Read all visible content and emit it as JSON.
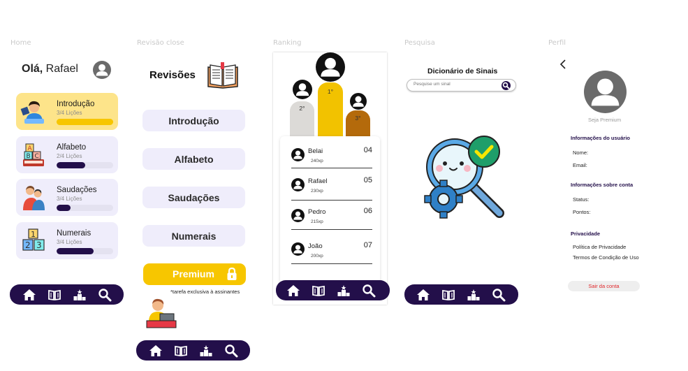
{
  "frames": {
    "home": "Home",
    "revisao": "Revisão close",
    "ranking": "Ranking",
    "pesquisa": "Pesquisa",
    "perfil": "Perfil"
  },
  "home": {
    "greeting_bold": "Olá,",
    "greeting_name": " Rafael",
    "lessons": [
      {
        "title": "Introdução",
        "progress_text": "3/4 Lições",
        "progress": 1.0,
        "icon": "teacher-icon"
      },
      {
        "title": "Alfabeto",
        "progress_text": "2/4 Lições",
        "progress": 0.5,
        "icon": "abc-blocks-book-icon"
      },
      {
        "title": "Saudações",
        "progress_text": "3/4 Lições",
        "progress": 0.25,
        "icon": "hug-people-icon"
      },
      {
        "title": "Numerais",
        "progress_text": "3/4 Lições",
        "progress": 0.65,
        "icon": "number-blocks-icon"
      }
    ]
  },
  "revisao": {
    "title": "Revisões",
    "items": [
      "Introdução",
      "Alfabeto",
      "Saudações",
      "Numerais"
    ],
    "premium_label": "Premium",
    "exclusive_note": "*tarefa exclusiva à assinantes"
  },
  "ranking": {
    "podium": [
      "2°",
      "1°",
      "3°"
    ],
    "rows": [
      {
        "name": "Belai",
        "xp": "240xp",
        "pos": "04"
      },
      {
        "name": "Rafael",
        "xp": "230xp",
        "pos": "05"
      },
      {
        "name": "Pedro",
        "xp": "215xp",
        "pos": "06"
      },
      {
        "name": "João",
        "xp": "200xp",
        "pos": "07"
      }
    ]
  },
  "pesquisa": {
    "title": "Dicionário de Sinais",
    "search_placeholder": "Pesquise um sinal"
  },
  "perfil": {
    "premium_link": "Seja Premium",
    "user_info_heading": "Informações do usuário",
    "name_label": "Nome:",
    "email_label": "Email:",
    "account_heading": "Informações sobre conta",
    "status_label": "Status:",
    "points_label": "Pontos:",
    "privacy_heading": "Privacidade",
    "privacy_policy": "Política de Privacidade",
    "terms": "Termos de Condição de Uso",
    "logout": "Sair da conta"
  },
  "colors": {
    "navbar": "#230f4a",
    "accent_yellow": "#f7c600",
    "card_bg": "#efedfb",
    "gold": "#f2c200",
    "silver": "#dcdad7",
    "bronze": "#b46a0b"
  },
  "nav_icons": [
    "home-icon",
    "book-icon",
    "ranking-podium-icon",
    "search-icon"
  ]
}
